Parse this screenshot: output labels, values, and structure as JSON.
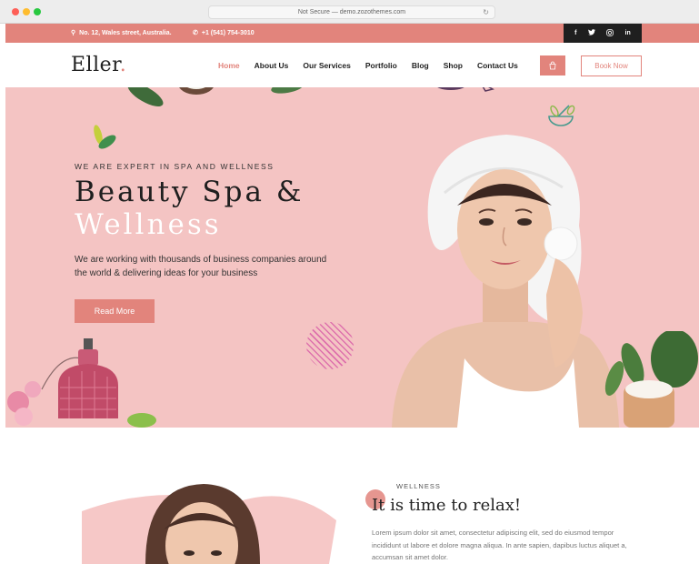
{
  "browser": {
    "url": "Not Secure — demo.zozothemes.com"
  },
  "topbar": {
    "address": "No. 12, Wales street, Australia.",
    "phone": "+1 (541) 754-3010",
    "social": [
      "f",
      "t",
      "ig",
      "in"
    ]
  },
  "nav": {
    "logo": "Eller",
    "logo_dot": ".",
    "items": [
      {
        "label": "Home",
        "active": true
      },
      {
        "label": "About Us"
      },
      {
        "label": "Our Services"
      },
      {
        "label": "Portfolio"
      },
      {
        "label": "Blog"
      },
      {
        "label": "Shop"
      },
      {
        "label": "Contact Us"
      }
    ],
    "book_label": "Book Now"
  },
  "hero": {
    "kicker": "WE ARE EXPERT IN SPA AND WELLNESS",
    "title_line1": "Beauty Spa &",
    "title_line2": "Wellness",
    "description": "We are working with thousands of business companies around the world & delivering ideas for your business",
    "cta_label": "Read More"
  },
  "section2": {
    "kicker": "WELLNESS",
    "title": "It is time to relax!",
    "paragraph": "Lorem ipsum dolor sit amet, consectetur adipiscing elit, sed do eiusmod tempor incididunt ut labore et dolore magna aliqua. In ante sapien, dapibus luctus aliquet a, accumsan sit amet dolor."
  },
  "colors": {
    "accent": "#e2847c",
    "hero_bg": "#f4c4c3",
    "dark": "#1f1f1f"
  }
}
